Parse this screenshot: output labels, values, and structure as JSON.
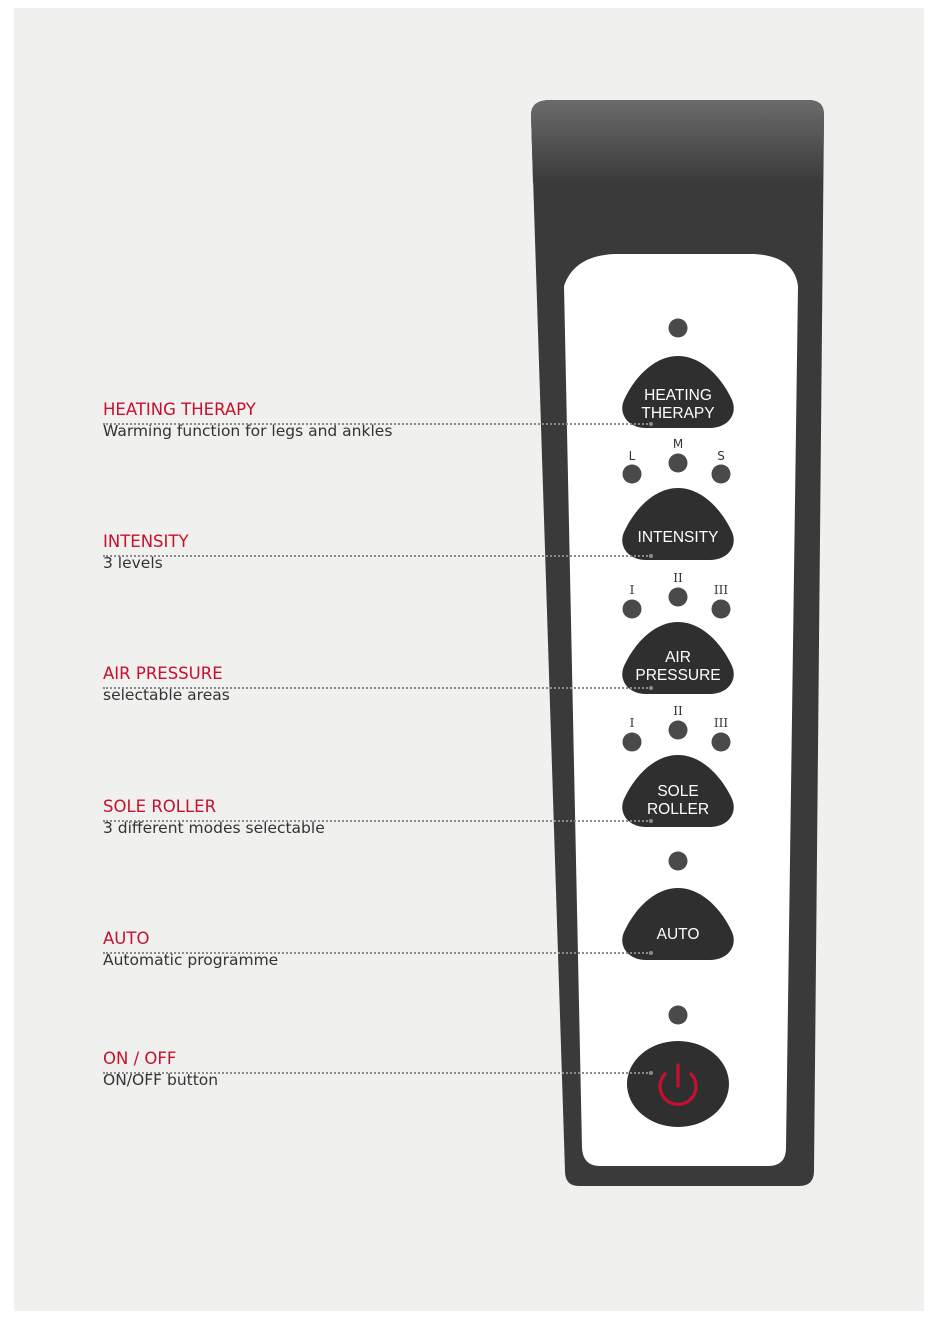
{
  "features": [
    {
      "id": "heating",
      "title": "HEATING THERAPY",
      "description": "Warming function for legs and ankles",
      "button_lines": [
        "HEATING",
        "THERAPY"
      ],
      "indicators": []
    },
    {
      "id": "intensity",
      "title": "INTENSITY",
      "description": "3 levels",
      "button_lines": [
        "INTENSITY"
      ],
      "indicators": [
        "L",
        "M",
        "S"
      ]
    },
    {
      "id": "air-pressure",
      "title": "AIR PRESSURE",
      "description": "selectable areas",
      "button_lines": [
        "AIR",
        "PRESSURE"
      ],
      "indicators": [
        "I",
        "II",
        "III"
      ]
    },
    {
      "id": "sole-roller",
      "title": "SOLE ROLLER",
      "description": "3 different modes selectable",
      "button_lines": [
        "SOLE",
        "ROLLER"
      ],
      "indicators": [
        "I",
        "II",
        "III"
      ]
    },
    {
      "id": "auto",
      "title": "AUTO",
      "description": "Automatic programme",
      "button_lines": [
        "AUTO"
      ],
      "indicators": []
    },
    {
      "id": "on-off",
      "title": "ON / OFF",
      "description": "ON/OFF button",
      "button_lines": [],
      "icon": "power-icon",
      "indicators": []
    }
  ],
  "colors": {
    "accent_red": "#c8102e",
    "remote_body": "#3a3a3a",
    "panel": "#ffffff",
    "button": "#2f2f2f",
    "indicator": "#4a4a4a",
    "background": "#f0f0ef"
  }
}
